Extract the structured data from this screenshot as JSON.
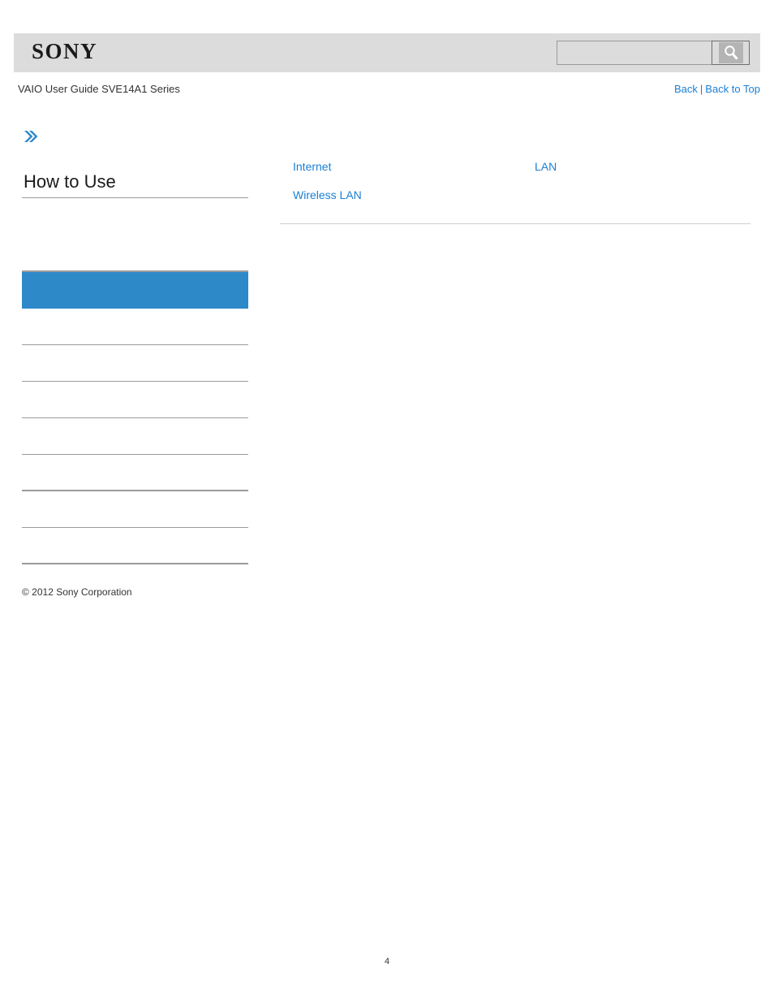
{
  "header": {
    "logo_text": "SONY",
    "search": {
      "value": "",
      "placeholder": "",
      "icon": "search-icon",
      "button_label": ""
    }
  },
  "doc_title": "VAIO User Guide SVE14A1 Series",
  "top_links": {
    "back": "Back",
    "separator": "|",
    "back_to_top": "Back to Top"
  },
  "sidebar": {
    "chevron_icon": "double-chevron-right-icon",
    "heading": "How to Use",
    "items": [
      {
        "label": "",
        "selected": false,
        "rule": "none"
      },
      {
        "label": "",
        "selected": false,
        "rule": "thin"
      },
      {
        "label": "",
        "selected": true,
        "rule": "none"
      },
      {
        "label": "",
        "selected": false,
        "rule": "thin"
      },
      {
        "label": "",
        "selected": false,
        "rule": "thin"
      },
      {
        "label": "",
        "selected": false,
        "rule": "thin"
      },
      {
        "label": "",
        "selected": false,
        "rule": "thin"
      },
      {
        "label": "",
        "selected": false,
        "rule": "thick"
      },
      {
        "label": "",
        "selected": false,
        "rule": "thin"
      },
      {
        "label": "",
        "selected": false,
        "rule": "thick"
      }
    ],
    "copyright": "© 2012 Sony Corporation"
  },
  "content": {
    "links": [
      {
        "label": "Internet",
        "column": "left"
      },
      {
        "label": "LAN",
        "column": "right"
      },
      {
        "label": "Wireless LAN",
        "column": "left"
      }
    ]
  },
  "footer": {
    "page_number": "4"
  },
  "colors": {
    "accent_blue": "#2e89c9",
    "link_blue": "#1a7fd4",
    "header_band": "#dcdcdc",
    "rule_gray": "#9b9b9b"
  }
}
